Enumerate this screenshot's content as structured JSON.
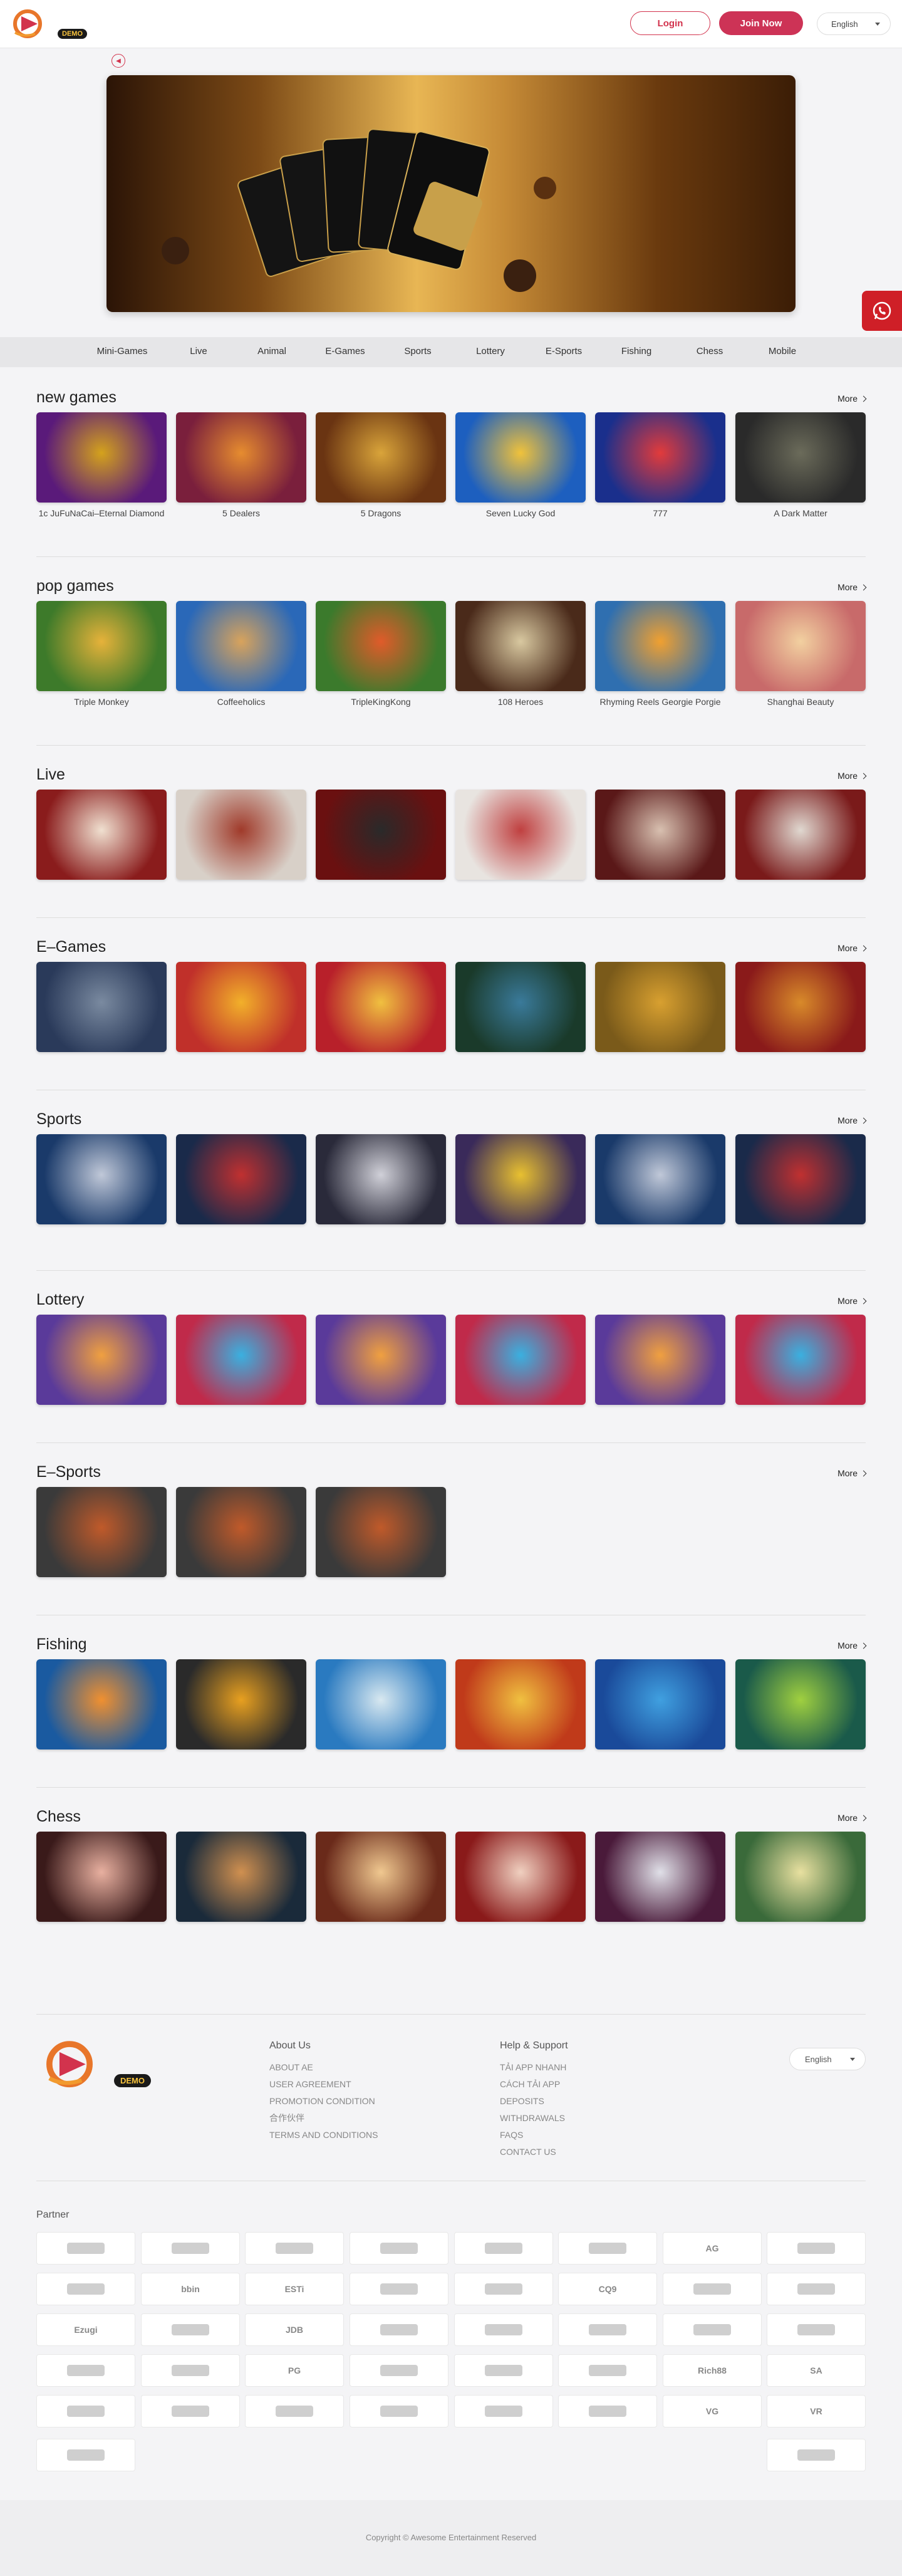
{
  "header": {
    "demo_badge": "DEMO",
    "login": "Login",
    "join": "Join Now",
    "language": "English"
  },
  "nav": [
    "Mini-Games",
    "Live",
    "Animal",
    "E-Games",
    "Sports",
    "Lottery",
    "E-Sports",
    "Fishing",
    "Chess",
    "Mobile"
  ],
  "more_label": "More",
  "sections": [
    {
      "title": "new games",
      "tiles": [
        {
          "caption": "1c JuFuNaCai–Eternal Diamond",
          "colors": [
            "#5a1a7a",
            "#d4a21c"
          ]
        },
        {
          "caption": "5 Dealers",
          "colors": [
            "#7a1f3c",
            "#e68c2f"
          ]
        },
        {
          "caption": "5 Dragons",
          "colors": [
            "#6a3412",
            "#d9a43a"
          ]
        },
        {
          "caption": "Seven Lucky God",
          "colors": [
            "#1d5fbf",
            "#f0c23b"
          ]
        },
        {
          "caption": "777",
          "colors": [
            "#1a2f8c",
            "#e23b3b"
          ]
        },
        {
          "caption": "A Dark Matter",
          "colors": [
            "#2a2a2a",
            "#6b6b5a"
          ]
        }
      ]
    },
    {
      "title": "pop games",
      "tiles": [
        {
          "caption": "Triple Monkey",
          "colors": [
            "#3d7a2a",
            "#e6b23a"
          ]
        },
        {
          "caption": "Coffeeholics",
          "colors": [
            "#2a68b8",
            "#d8a35c"
          ]
        },
        {
          "caption": "TripleKingKong",
          "colors": [
            "#3b7a2c",
            "#e05b2a"
          ]
        },
        {
          "caption": "108 Heroes",
          "colors": [
            "#4a2a1a",
            "#d8c8a0"
          ]
        },
        {
          "caption": "Rhyming Reels Georgie Porgie",
          "colors": [
            "#2f6fb0",
            "#f0a030"
          ]
        },
        {
          "caption": "Shanghai Beauty",
          "colors": [
            "#c86a6a",
            "#f2d0a0"
          ]
        }
      ]
    },
    {
      "title": "Live",
      "tiles": [
        {
          "caption": "",
          "colors": [
            "#8a1c1c",
            "#f0e0d0"
          ]
        },
        {
          "caption": "",
          "colors": [
            "#d8d0c8",
            "#a03a2a"
          ]
        },
        {
          "caption": "",
          "colors": [
            "#6a1010",
            "#2a2a2a"
          ]
        },
        {
          "caption": "",
          "colors": [
            "#e8e4e0",
            "#c04040"
          ]
        },
        {
          "caption": "",
          "colors": [
            "#5a1818",
            "#d8c0b0"
          ]
        },
        {
          "caption": "",
          "colors": [
            "#7a1a1a",
            "#e0d8d0"
          ]
        }
      ]
    },
    {
      "title": "E–Games",
      "tiles": [
        {
          "caption": "",
          "colors": [
            "#2a3a5a",
            "#7a8aa0"
          ]
        },
        {
          "caption": "",
          "colors": [
            "#c0302a",
            "#f2b02a"
          ]
        },
        {
          "caption": "",
          "colors": [
            "#b8202a",
            "#f0c040"
          ]
        },
        {
          "caption": "",
          "colors": [
            "#1a3a2a",
            "#3a7a9a"
          ]
        },
        {
          "caption": "",
          "colors": [
            "#7a5a1a",
            "#d8a030"
          ]
        },
        {
          "caption": "",
          "colors": [
            "#8a1a1a",
            "#d88a2a"
          ]
        }
      ]
    },
    {
      "title": "Sports",
      "tiles": [
        {
          "caption": "",
          "colors": [
            "#1a3a6a",
            "#c0c8d8"
          ]
        },
        {
          "caption": "",
          "colors": [
            "#1a2a4a",
            "#c03030"
          ]
        },
        {
          "caption": "",
          "colors": [
            "#2a2a3a",
            "#d0d0d8"
          ]
        },
        {
          "caption": "",
          "colors": [
            "#3a2a5a",
            "#e8c030"
          ]
        },
        {
          "caption": "",
          "colors": [
            "#1a3a6a",
            "#c0c8d8"
          ]
        },
        {
          "caption": "",
          "colors": [
            "#1a2a4a",
            "#c03030"
          ]
        }
      ]
    },
    {
      "title": "Lottery",
      "tiles": [
        {
          "caption": "",
          "colors": [
            "#5a3a9a",
            "#f0a040"
          ]
        },
        {
          "caption": "",
          "colors": [
            "#c02a4a",
            "#3ab0e0"
          ]
        },
        {
          "caption": "",
          "colors": [
            "#5a3a9a",
            "#f0a040"
          ]
        },
        {
          "caption": "",
          "colors": [
            "#c02a4a",
            "#3ab0e0"
          ]
        },
        {
          "caption": "",
          "colors": [
            "#5a3a9a",
            "#f0a040"
          ]
        },
        {
          "caption": "",
          "colors": [
            "#c02a4a",
            "#3ab0e0"
          ]
        }
      ]
    },
    {
      "title": "E–Sports",
      "tiles": [
        {
          "caption": "",
          "colors": [
            "#3a3a3a",
            "#c05a2a"
          ]
        },
        {
          "caption": "",
          "colors": [
            "#3a3a3a",
            "#c05a2a"
          ]
        },
        {
          "caption": "",
          "colors": [
            "#3a3a3a",
            "#c05a2a"
          ]
        }
      ]
    },
    {
      "title": "Fishing",
      "tiles": [
        {
          "caption": "",
          "colors": [
            "#1a5aa0",
            "#f09030"
          ]
        },
        {
          "caption": "",
          "colors": [
            "#2a2a2a",
            "#e8a020"
          ]
        },
        {
          "caption": "",
          "colors": [
            "#2a7ac0",
            "#d8e8f0"
          ]
        },
        {
          "caption": "",
          "colors": [
            "#c03a1a",
            "#f0c040"
          ]
        },
        {
          "caption": "",
          "colors": [
            "#1a4a9a",
            "#40a0e0"
          ]
        },
        {
          "caption": "",
          "colors": [
            "#1a5a4a",
            "#a0d040"
          ]
        }
      ]
    },
    {
      "title": "Chess",
      "tiles": [
        {
          "caption": "",
          "colors": [
            "#3a1a1a",
            "#e8b0a0"
          ]
        },
        {
          "caption": "",
          "colors": [
            "#1a2a3a",
            "#d09050"
          ]
        },
        {
          "caption": "",
          "colors": [
            "#6a2a1a",
            "#f0c890"
          ]
        },
        {
          "caption": "",
          "colors": [
            "#8a1a1a",
            "#f0d0c0"
          ]
        },
        {
          "caption": "",
          "colors": [
            "#4a1a3a",
            "#e0e0e8"
          ]
        },
        {
          "caption": "",
          "colors": [
            "#3a6a3a",
            "#e8e0a0"
          ]
        }
      ]
    }
  ],
  "footer": {
    "demo_badge": "DEMO",
    "about": {
      "title": "About Us",
      "links": [
        "ABOUT AE",
        "USER AGREEMENT",
        "PROMOTION CONDITION",
        "合作伙伴",
        "TERMS AND CONDITIONS"
      ]
    },
    "help": {
      "title": "Help & Support",
      "links": [
        "TẢI APP NHANH",
        "CÁCH TẢI APP",
        "DEPOSITS",
        "WITHDRAWALS",
        "FAQS",
        "CONTACT US"
      ]
    },
    "language": "English"
  },
  "partner_title": "Partner",
  "partners": [
    "",
    "",
    "",
    "",
    "",
    "",
    "AG",
    "",
    "",
    "bbin",
    "ESTi",
    "",
    "",
    "CQ9",
    "",
    "",
    "Ezugi",
    "",
    "JDB",
    "",
    "",
    "",
    "",
    "",
    "",
    "",
    "PG",
    "",
    "",
    "",
    "Rich88",
    "SA",
    "",
    "",
    "",
    "",
    "",
    "",
    "VG",
    "VR",
    "",
    ""
  ],
  "copyright": "Copyright © Awesome Entertainment Reserved"
}
